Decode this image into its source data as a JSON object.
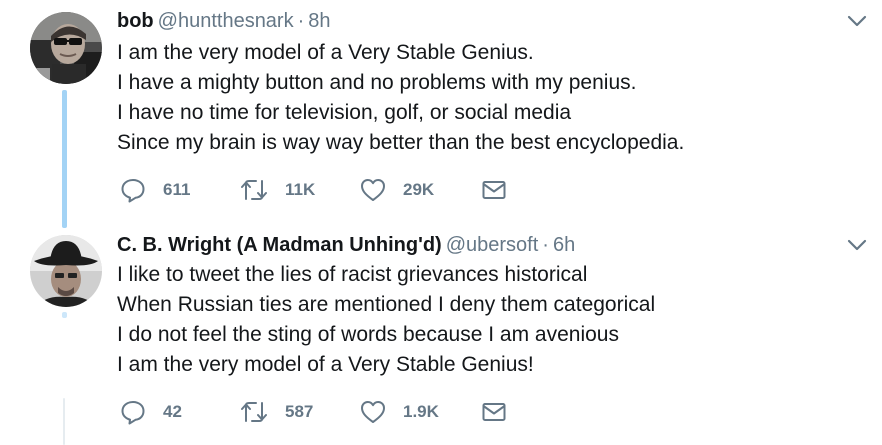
{
  "tweets": [
    {
      "name": "bob",
      "handle": "@huntthesnark",
      "separator": "·",
      "time": "8h",
      "lines": [
        "I am the very model of a Very Stable Genius.",
        "I have a mighty button and no problems with my penius.",
        "I have no time for television, golf, or social media",
        "Since my brain is way way better than the best encyclopedia."
      ],
      "replies": "611",
      "retweets": "11K",
      "likes": "29K",
      "avatar_icon": "avatar-bob-sunglasses"
    },
    {
      "name": "C. B. Wright (A Madman Unhing'd)",
      "handle": "@ubersoft",
      "separator": "·",
      "time": "6h",
      "lines": [
        "I like to tweet the lies of racist grievances historical",
        "When Russian ties are mentioned I deny them categorical",
        "I do not feel the sting of words because I am avenious",
        "I am the very model of a Very Stable Genius!"
      ],
      "replies": "42",
      "retweets": "587",
      "likes": "1.9K",
      "avatar_icon": "avatar-cowboy-hat"
    }
  ],
  "colors": {
    "text": "#14171a",
    "secondary": "#657786",
    "thread_line": "#a3d3f5"
  },
  "icons": [
    "reply-icon",
    "retweet-icon",
    "like-icon",
    "direct-message-icon",
    "chevron-down-icon"
  ]
}
